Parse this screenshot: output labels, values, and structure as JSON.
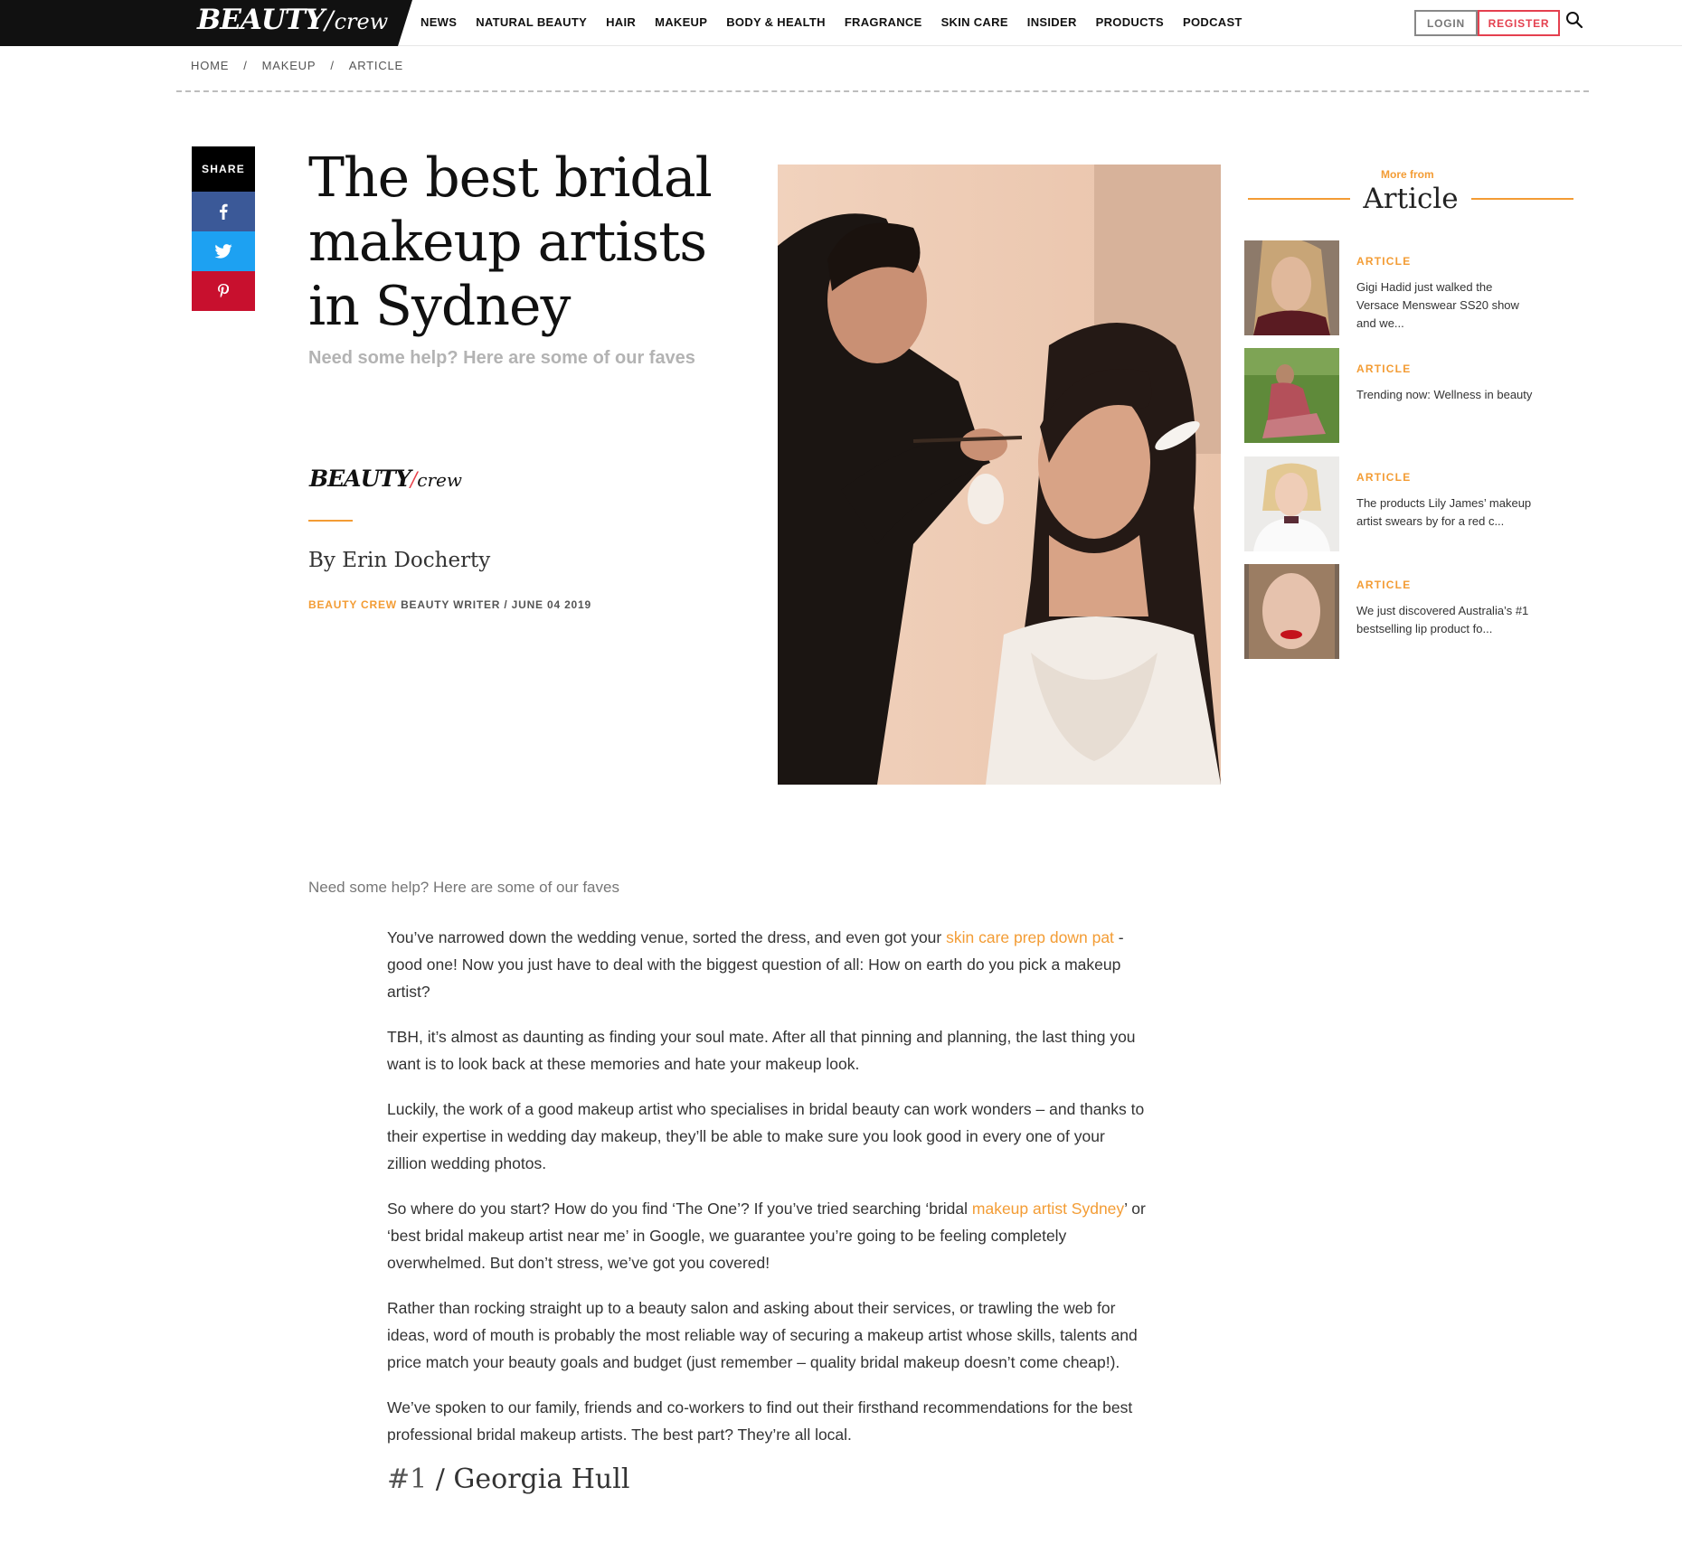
{
  "header": {
    "logo": {
      "beauty": "BEAUTY",
      "slash": "/",
      "crew": "crew"
    },
    "nav": [
      "NEWS",
      "NATURAL BEAUTY",
      "HAIR",
      "MAKEUP",
      "BODY & HEALTH",
      "FRAGRANCE",
      "SKIN CARE",
      "INSIDER",
      "PRODUCTS",
      "PODCAST"
    ],
    "login_label": "LOGIN",
    "register_label": "REGISTER"
  },
  "breadcrumb": {
    "home": "HOME",
    "section": "MAKEUP",
    "current": "ARTICLE",
    "separator": "/"
  },
  "share": {
    "label": "SHARE"
  },
  "article": {
    "title": "The best bridal makeup artists in Sydney",
    "subtitle": "Need some help? Here are some of our faves",
    "brand": {
      "beauty": "BEAUTY",
      "slash": "/",
      "crew": "crew"
    },
    "byline": "By Erin Docherty",
    "meta_org": "BEAUTY CREW",
    "meta_rest": "BEAUTY WRITER / JUNE 04 2019",
    "standfirst": "Need some help? Here are some of our faves",
    "p1_a": "You’ve narrowed down the wedding venue, sorted the dress, and even got your ",
    "p1_link": "skin care prep down pat",
    "p1_b": " - good one! Now you just have to deal with the biggest question of all: How on earth do you pick a makeup artist?",
    "p2": "TBH, it’s almost as daunting as finding your soul mate. After all that pinning and planning, the last thing you want is to look back at these memories and hate your makeup look.",
    "p3": "Luckily, the work of a good makeup artist who specialises in bridal beauty can work wonders – and thanks to their expertise in wedding day makeup, they’ll be able to make sure you look good in every one of your zillion wedding photos.",
    "p4_a": "So where do you start? How do you find ‘The One’? If you’ve tried searching ‘bridal ",
    "p4_link": "makeup artist Sydney",
    "p4_b": "’ or ‘best bridal makeup artist near me’ in Google, we guarantee you’re going to be feeling completely overwhelmed. But don’t stress, we’ve got you covered!",
    "p5": "Rather than rocking straight up to a beauty salon and asking about their services, or trawling the web for ideas, word of mouth is probably the most reliable way of securing a makeup artist whose skills, talents and price match your beauty goals and budget (just remember – quality bridal makeup doesn’t come cheap!).",
    "p6": "We’ve spoken to our family, friends and co-workers to find out their firsthand recommendations for the best professional bridal makeup artists. The best part? They’re all local.",
    "h_num": "#1",
    "h_text": " / Georgia Hull"
  },
  "sidebar": {
    "more_from": "More from",
    "heading": "Article",
    "items": [
      {
        "tag": "ARTICLE",
        "text": "Gigi Hadid just walked the Versace Menswear SS20 show and we..."
      },
      {
        "tag": "ARTICLE",
        "text": "Trending now: Wellness in beauty"
      },
      {
        "tag": "ARTICLE",
        "text": "The products Lily James’ makeup artist swears by for a red c..."
      },
      {
        "tag": "ARTICLE",
        "text": "We just discovered Australia’s #1 bestselling lip product fo..."
      }
    ]
  },
  "colors": {
    "accent": "#f39c34",
    "register": "#e4404f",
    "facebook": "#3b5998",
    "twitter": "#1da1f2",
    "pinterest": "#c8102e"
  }
}
